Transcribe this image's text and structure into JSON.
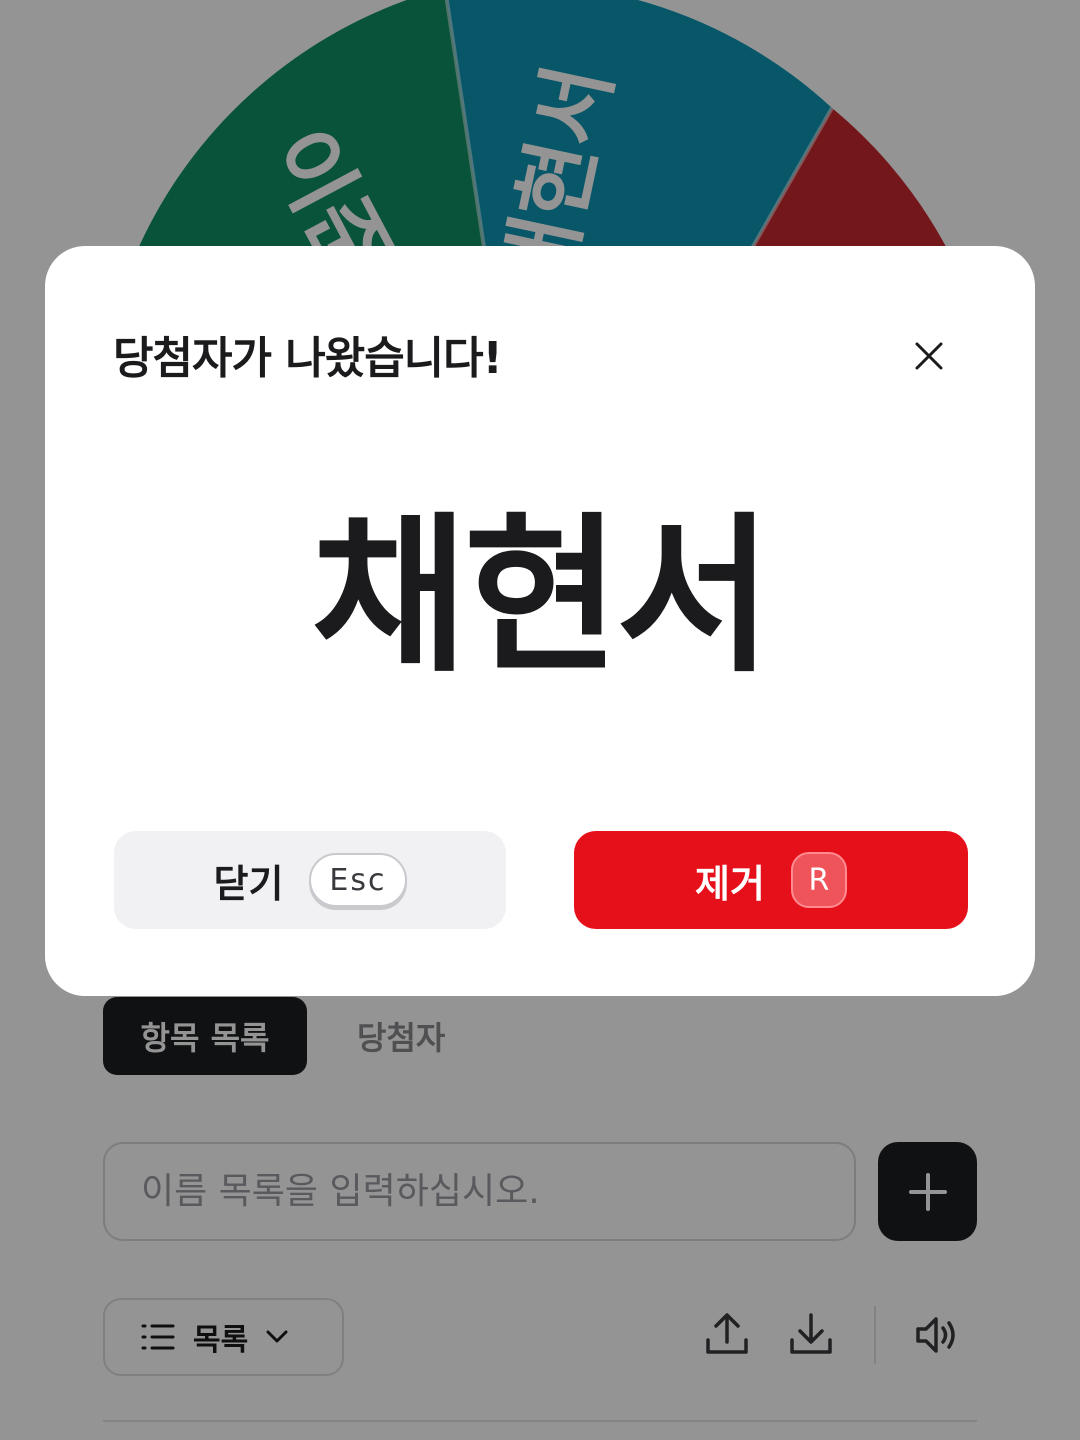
{
  "wheel": {
    "segments": [
      {
        "label": "이준영",
        "color": "#0f8f63"
      },
      {
        "label": "채현서",
        "color": "#0f97b4"
      },
      {
        "label": "",
        "color": "#c9292f"
      }
    ]
  },
  "tabs": [
    {
      "label": "항목 목록",
      "active": true
    },
    {
      "label": "당첨자",
      "active": false
    }
  ],
  "entry": {
    "placeholder": "이름 목록을 입력하십시오.",
    "value": ""
  },
  "toolbar": {
    "list_mode_label": "목록",
    "icons": [
      "list-icon",
      "chevron-down-icon",
      "upload-icon",
      "download-icon",
      "volume-icon"
    ]
  },
  "modal": {
    "title": "당첨자가 나왔습니다!",
    "winner": "채현서",
    "close_label": "닫기",
    "close_key": "Esc",
    "remove_label": "제거",
    "remove_key": "R"
  },
  "colors": {
    "dark": "#1d1e20",
    "accent_red": "#e6101a",
    "overlay": "rgba(0,0,0,0.42)"
  }
}
